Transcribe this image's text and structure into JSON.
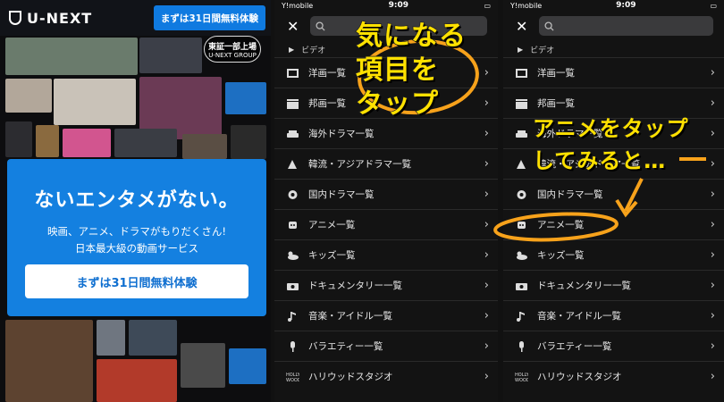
{
  "panel1": {
    "logo": "U-NEXT",
    "trial_top": "まずは31日間無料体験",
    "listed_small": "東証一部上場",
    "listed_sub": "U-NEXT GROUP",
    "headline": "ないエンタメがない。",
    "sub1": "映画、アニメ、ドラマがもりだくさん!",
    "sub2": "日本最大級の動画サービス",
    "cta": "まずは31日間無料体験"
  },
  "status": {
    "carrier": "Y!mobile",
    "time": "9:09"
  },
  "menu": {
    "section": "ビデオ",
    "items": [
      {
        "label": "洋画一覧",
        "icon": "film-icon"
      },
      {
        "label": "邦画一覧",
        "icon": "film-clapper-icon"
      },
      {
        "label": "海外ドラマ一覧",
        "icon": "sofa-icon"
      },
      {
        "label": "韓流・アジアドラマ一覧",
        "icon": "fan-icon"
      },
      {
        "label": "国内ドラマ一覧",
        "icon": "flower-icon"
      },
      {
        "label": "アニメ一覧",
        "icon": "robot-icon"
      },
      {
        "label": "キッズ一覧",
        "icon": "duck-icon"
      },
      {
        "label": "ドキュメンタリー一覧",
        "icon": "camera-icon"
      },
      {
        "label": "音楽・アイドル一覧",
        "icon": "music-note-icon"
      },
      {
        "label": "バラエティー一覧",
        "icon": "microphone-icon"
      },
      {
        "label": "ハリウッドスタジオ",
        "icon": "hollywood-icon"
      }
    ]
  },
  "annotations": {
    "tap_line1": "気になる",
    "tap_line2": "項目を",
    "tap_line3": "タップ",
    "anime_line1": "アニメをタップ",
    "anime_line2": "してみると…"
  },
  "colors": {
    "accent_blue": "#1480e0",
    "highlight": "#ffe100",
    "circle_orange": "#f7a21b"
  }
}
